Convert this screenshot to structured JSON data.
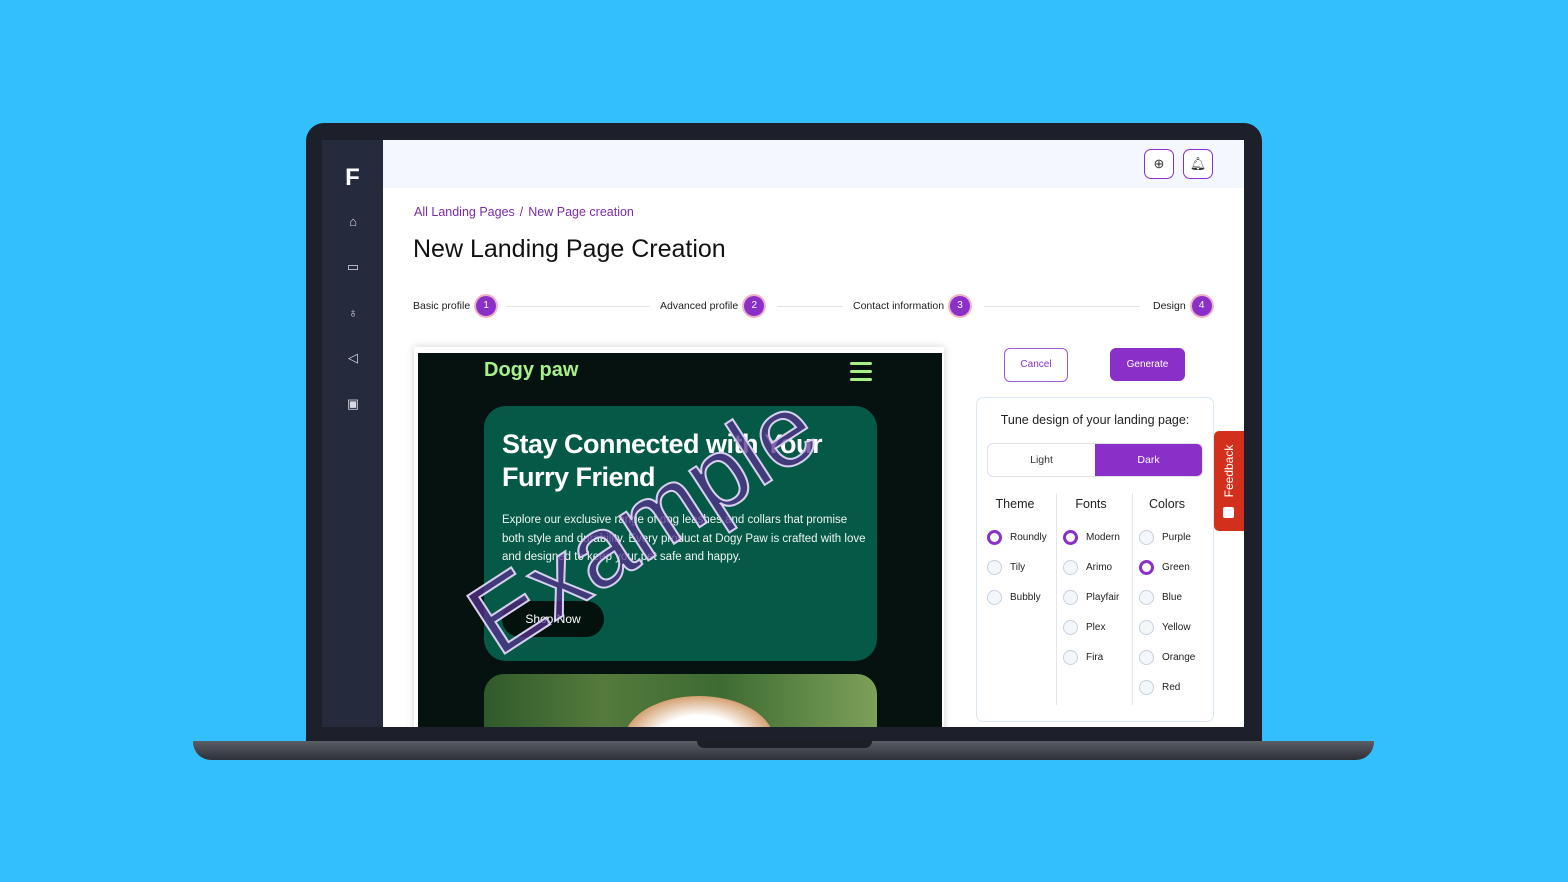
{
  "sidebar": {
    "logo": "F",
    "items": [
      {
        "icon": "home-icon"
      },
      {
        "icon": "monitor-icon"
      },
      {
        "icon": "lightbulb-icon"
      },
      {
        "icon": "megaphone-icon"
      },
      {
        "icon": "briefcase-icon"
      }
    ]
  },
  "topbar": {
    "icons": [
      "globe-icon",
      "bell-icon"
    ]
  },
  "breadcrumb": {
    "items": [
      "All Landing Pages",
      "New Page creation"
    ],
    "separator": "/"
  },
  "page_title": "New Landing Page Creation",
  "steps": [
    {
      "label": "Basic profile",
      "num": "1"
    },
    {
      "label": "Advanced profile",
      "num": "2"
    },
    {
      "label": "Contact information",
      "num": "3"
    },
    {
      "label": "Design",
      "num": "4"
    }
  ],
  "preview": {
    "brand": "Dogy paw",
    "hero_title": "Stay Connected with Your Furry Friend",
    "hero_text": "Explore our exclusive range of dog leashes and collars that promise both style and durability. Every product at Dogy Paw is crafted with love and designed to keep your pet safe and happy.",
    "cta": "Shop Now",
    "watermark": "Example",
    "brand_color": "#a6f08a",
    "hero_color": "#055a47"
  },
  "actions": {
    "cancel": "Cancel",
    "generate": "Generate"
  },
  "design_panel": {
    "title": "Tune design of your landing page:",
    "mode": {
      "options": [
        "Light",
        "Dark"
      ],
      "selected": "Dark"
    },
    "theme": {
      "label": "Theme",
      "options": [
        "Roundly",
        "Tily",
        "Bubbly"
      ],
      "selected": "Roundly"
    },
    "fonts": {
      "label": "Fonts",
      "options": [
        "Modern",
        "Arimo",
        "Playfair",
        "Plex",
        "Fira"
      ],
      "selected": "Modern"
    },
    "colors": {
      "label": "Colors",
      "options": [
        "Purple",
        "Green",
        "Blue",
        "Yellow",
        "Orange",
        "Red"
      ],
      "selected": "Green"
    }
  },
  "feedback": "Feedback",
  "accent": "#8b2fc9"
}
